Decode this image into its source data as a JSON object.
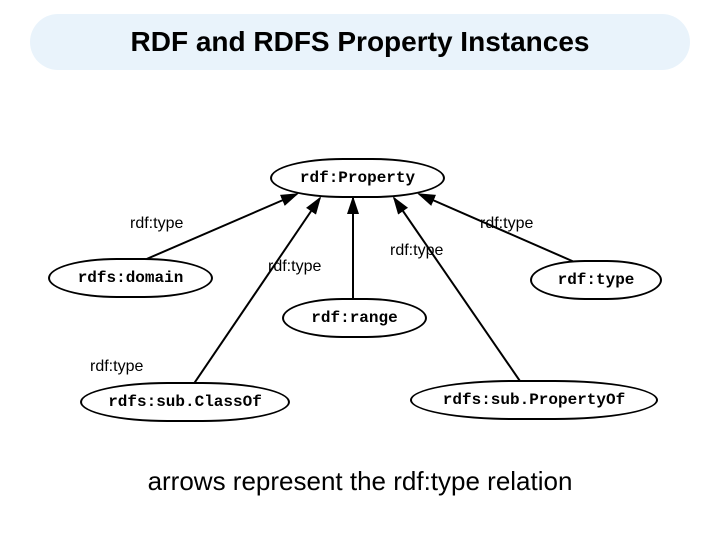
{
  "title": "RDF and RDFS Property Instances",
  "caption": "arrows represent the rdf:type relation",
  "nodes": {
    "property": "rdf:Property",
    "domain": "rdfs:domain",
    "range": "rdf:range",
    "rdftype": "rdf:type",
    "subclass": "rdfs:sub.ClassOf",
    "subprop": "rdfs:sub.PropertyOf"
  },
  "edge_labels": {
    "e1": "rdf:type",
    "e2": "rdf:type",
    "e3": "rdf:type",
    "e4": "rdf:type",
    "e5": "rdf:type"
  }
}
